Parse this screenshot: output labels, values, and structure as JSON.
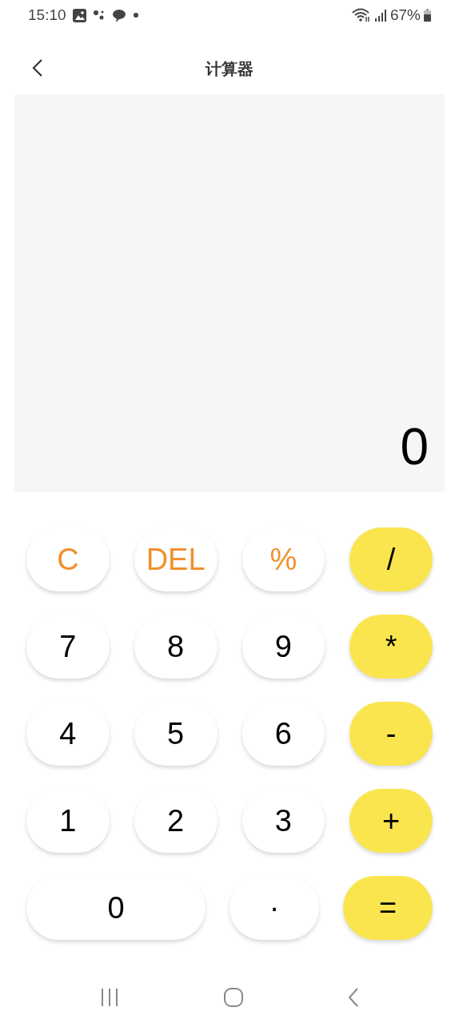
{
  "status_bar": {
    "time": "15:10",
    "battery": "67%"
  },
  "header": {
    "title": "计算器"
  },
  "display": {
    "value": "0"
  },
  "keypad": [
    [
      {
        "label": "C",
        "kind": "function"
      },
      {
        "label": "DEL",
        "kind": "function"
      },
      {
        "label": "%",
        "kind": "function"
      },
      {
        "label": "/",
        "kind": "operator"
      }
    ],
    [
      {
        "label": "7",
        "kind": "digit"
      },
      {
        "label": "8",
        "kind": "digit"
      },
      {
        "label": "9",
        "kind": "digit"
      },
      {
        "label": "*",
        "kind": "operator"
      }
    ],
    [
      {
        "label": "4",
        "kind": "digit"
      },
      {
        "label": "5",
        "kind": "digit"
      },
      {
        "label": "6",
        "kind": "digit"
      },
      {
        "label": "-",
        "kind": "operator"
      }
    ],
    [
      {
        "label": "1",
        "kind": "digit"
      },
      {
        "label": "2",
        "kind": "digit"
      },
      {
        "label": "3",
        "kind": "digit"
      },
      {
        "label": "+",
        "kind": "operator"
      }
    ],
    [
      {
        "label": "0",
        "kind": "digit",
        "wide": true
      },
      {
        "label": "·",
        "kind": "digit",
        "wide": false
      },
      {
        "label": "=",
        "kind": "operator",
        "wide": false
      }
    ]
  ]
}
